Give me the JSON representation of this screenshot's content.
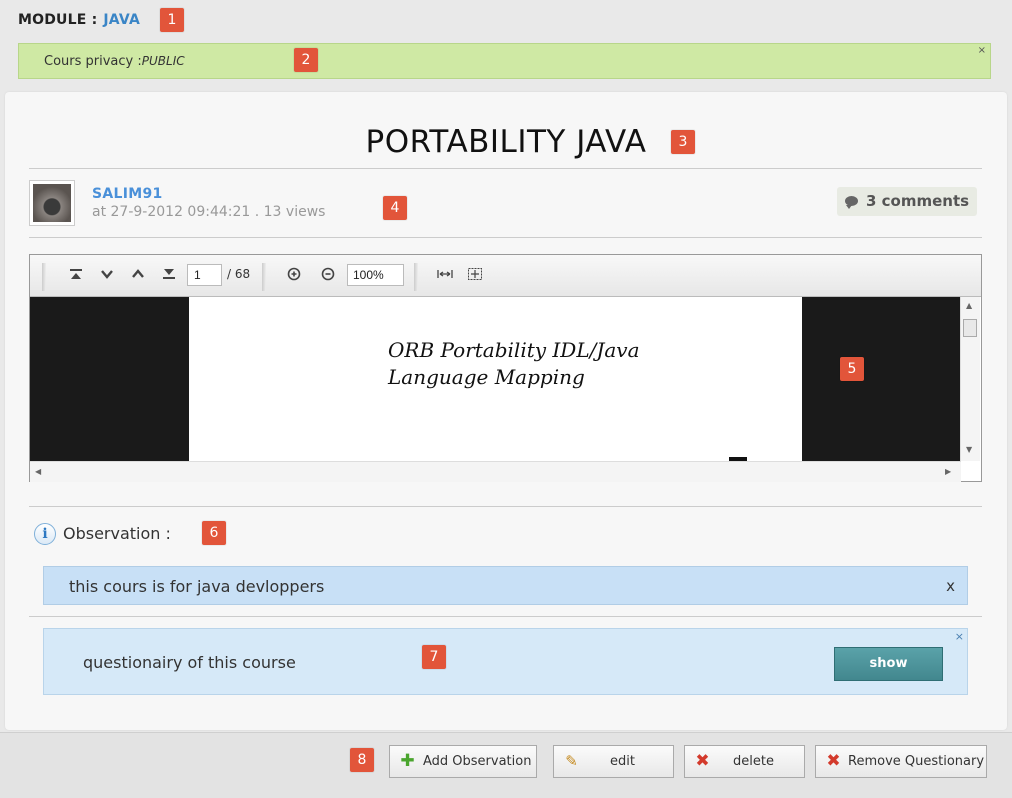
{
  "module": {
    "label": "MODULE :",
    "value": "JAVA"
  },
  "privacy": {
    "label": "Cours privacy :",
    "value": "PUBLIC",
    "close": "×"
  },
  "course": {
    "title": "PORTABILITY JAVA",
    "author": "SALIM91",
    "meta": "at 27-9-2012 09:44:21 . 13 views",
    "comments": "3 comments"
  },
  "viewer": {
    "page_current": "1",
    "page_total": "/ 68",
    "zoom": "100%",
    "doc_title_line1": "ORB Portability IDL/Java",
    "doc_title_line2": "Language Mapping"
  },
  "observation": {
    "label": "Observation :",
    "text": "this cours is for java devloppers",
    "close": "x"
  },
  "questionary": {
    "text": "questionairy of this course",
    "show_label": "show",
    "close": "×"
  },
  "actions": {
    "add": "Add Observation",
    "edit": "edit",
    "delete": "delete",
    "remove": "Remove Questionary"
  },
  "badges": [
    "1",
    "2",
    "3",
    "4",
    "5",
    "6",
    "7",
    "8"
  ],
  "colors": {
    "accent_blue": "#3a85c6",
    "badge": "#e2553a",
    "success": "#cfe9a4",
    "info": "#c8e0f6",
    "show_button": "#4a9098"
  }
}
